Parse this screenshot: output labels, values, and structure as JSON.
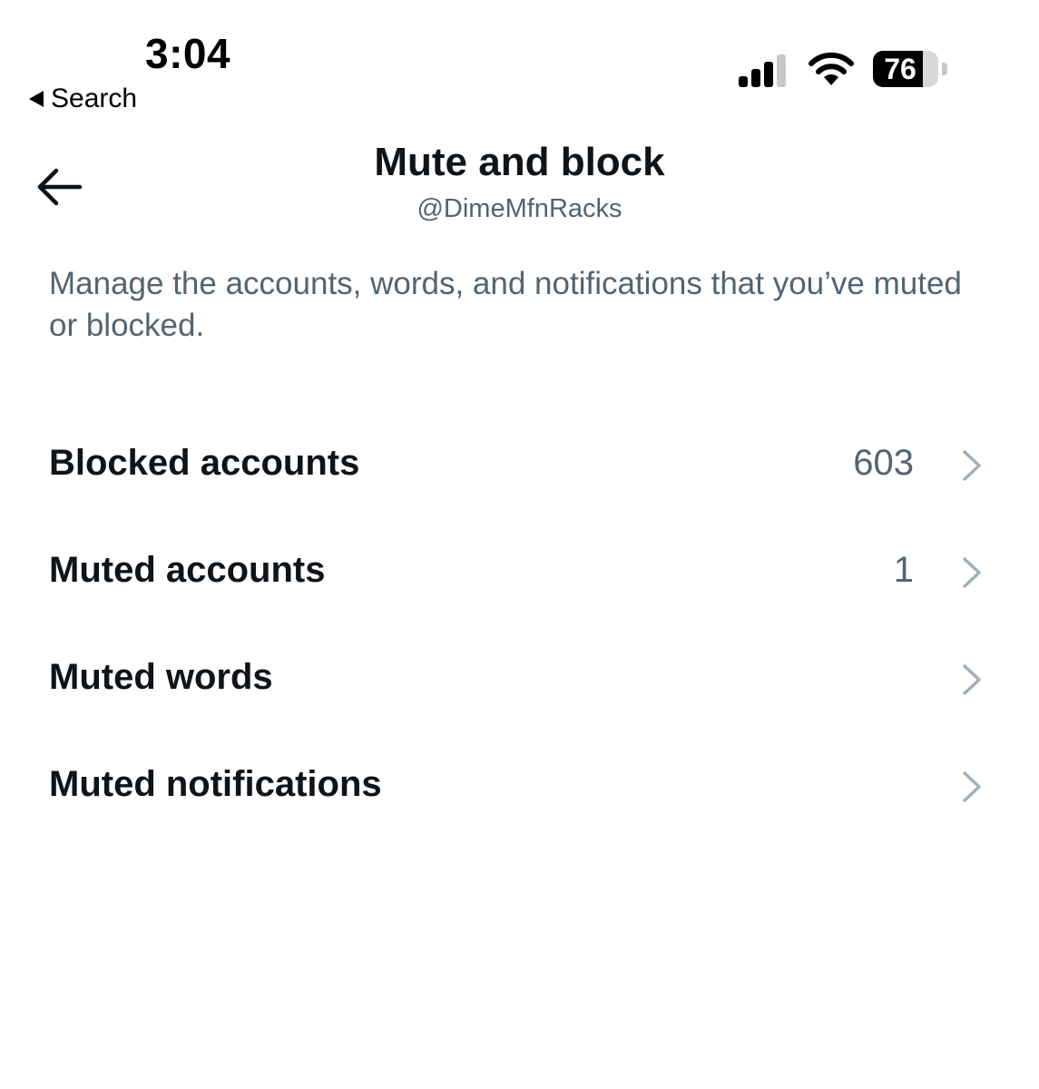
{
  "status_bar": {
    "time": "3:04",
    "back_app_label": "Search",
    "battery_level": "76",
    "battery_fraction": 0.76,
    "signal_bars_active": 3,
    "signal_bars_total": 4
  },
  "header": {
    "title": "Mute and block",
    "username": "@DimeMfnRacks",
    "back_icon": "arrow-left-icon"
  },
  "description": "Manage the accounts, words, and notifications that you’ve muted or blocked.",
  "settings": [
    {
      "label": "Blocked accounts",
      "count": "603"
    },
    {
      "label": "Muted accounts",
      "count": "1"
    },
    {
      "label": "Muted words",
      "count": ""
    },
    {
      "label": "Muted notifications",
      "count": ""
    }
  ],
  "colors": {
    "primary_text": "#0f1419",
    "secondary_text": "#536471",
    "chevron": "#a3afb9",
    "background": "#ffffff"
  }
}
